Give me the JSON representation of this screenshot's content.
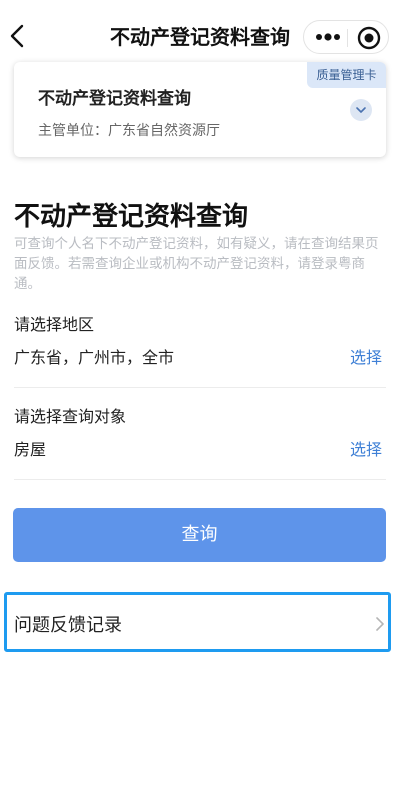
{
  "nav": {
    "title": "不动产登记资料查询",
    "back_icon": "chevron-left-icon",
    "more_icon": "more-dots-icon",
    "close_icon": "target-circle-icon"
  },
  "card": {
    "title": "不动产登记资料查询",
    "subtitle": "主管单位：广东省自然资源厅",
    "badge": "质量管理卡",
    "expand_icon": "chevron-down-icon"
  },
  "main": {
    "title": "不动产登记资料查询",
    "description": "可查询个人名下不动产登记资料，如有疑义，请在查询结果页面反馈。若需查询企业或机构不动产登记资料，请登录粤商通。",
    "region": {
      "label": "请选择地区",
      "value": "广东省，广州市，全市",
      "action": "选择"
    },
    "target": {
      "label": "请选择查询对象",
      "value": "房屋",
      "action": "选择"
    },
    "query_button": "查询"
  },
  "feedback": {
    "label": "问题反馈记录",
    "arrow_icon": "chevron-right-icon"
  },
  "colors": {
    "accent": "#3f80d6",
    "button": "#5e94ea",
    "highlight_border": "#1e9bf0",
    "badge_bg": "#dbe7f8"
  }
}
